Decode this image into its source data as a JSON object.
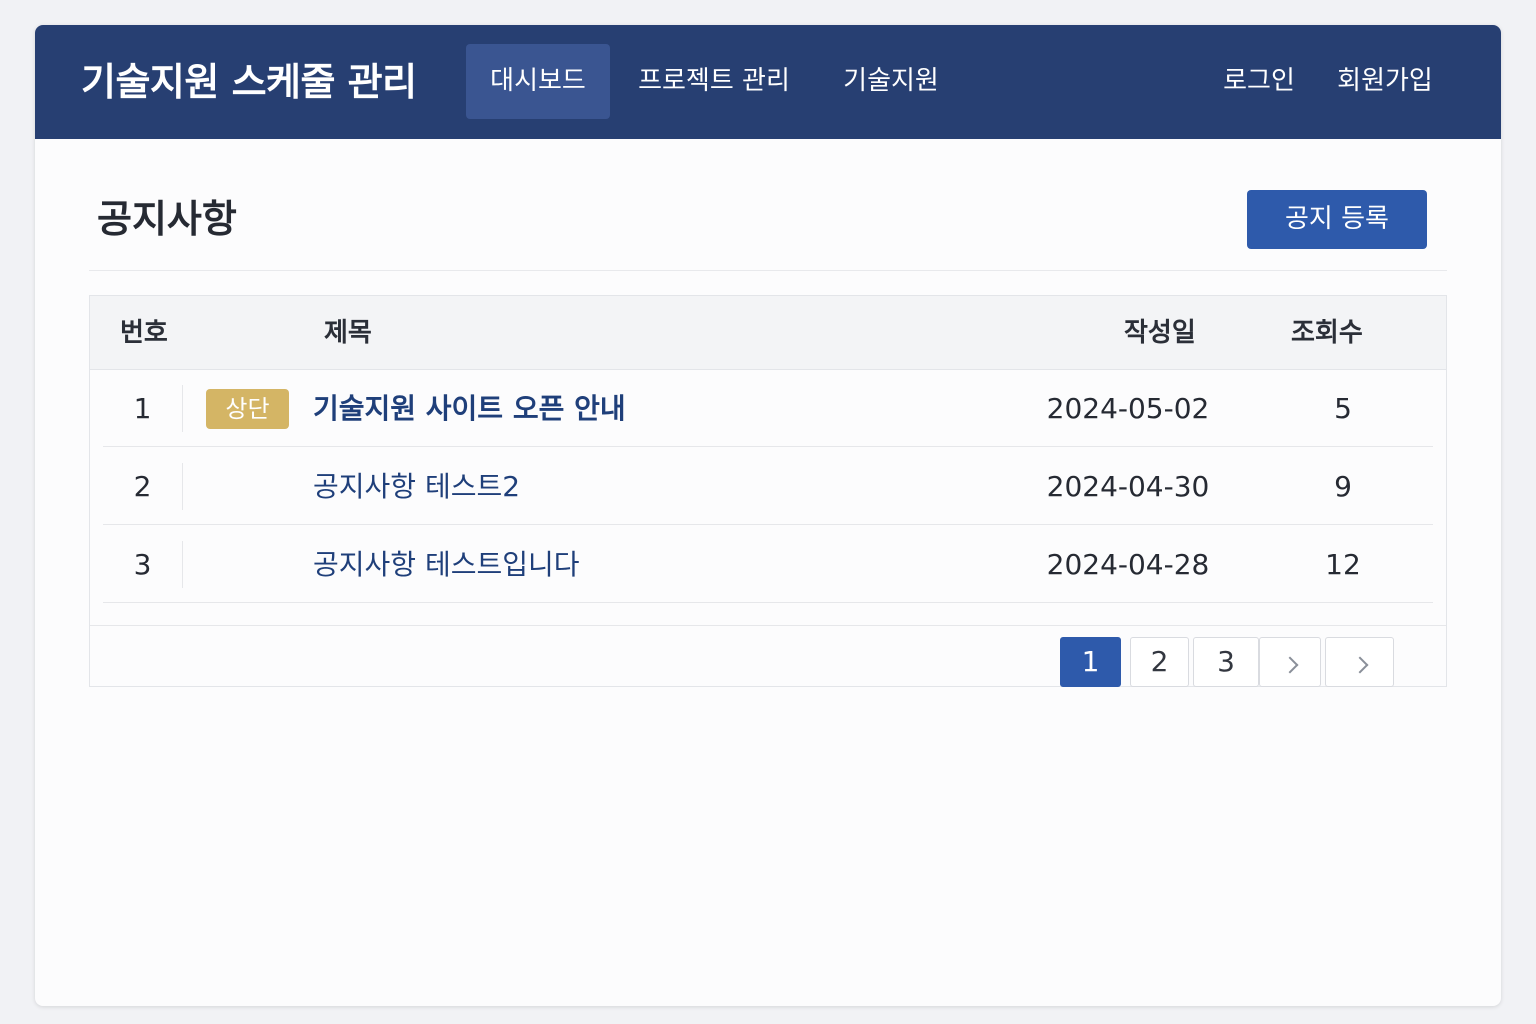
{
  "nav": {
    "brand": "기술지원 스케줄 관리",
    "links": [
      "대시보드",
      "프로젝트 관리",
      "기술지원"
    ],
    "right_links": [
      "로그인",
      "회원가입"
    ]
  },
  "page": {
    "title": "공지사항",
    "register_button": "공지 등록"
  },
  "table": {
    "headers": {
      "number": "번호",
      "title": "제목",
      "date": "작성일",
      "views": "조회수"
    },
    "rows": [
      {
        "number": "1",
        "badge": "상단",
        "title": "기술지원 사이트 오픈 안내",
        "date": "2024-05-02",
        "views": "5"
      },
      {
        "number": "2",
        "title": "공지사항 테스트2",
        "date": "2024-04-30",
        "views": "9"
      },
      {
        "number": "3",
        "title": "공지사항 테스트입니다",
        "date": "2024-04-28",
        "views": "12"
      }
    ]
  },
  "pagination": {
    "pages": [
      "1",
      "2",
      "3"
    ],
    "current": "1",
    "next_icon": "chevron-right-icon",
    "last_icon": "chevron-right-icon"
  },
  "colors": {
    "navbar": "#273f72",
    "nav_active": "#3a5591",
    "primary": "#2e5aab",
    "badge": "#d4b565",
    "link": "#1f3f7a"
  }
}
